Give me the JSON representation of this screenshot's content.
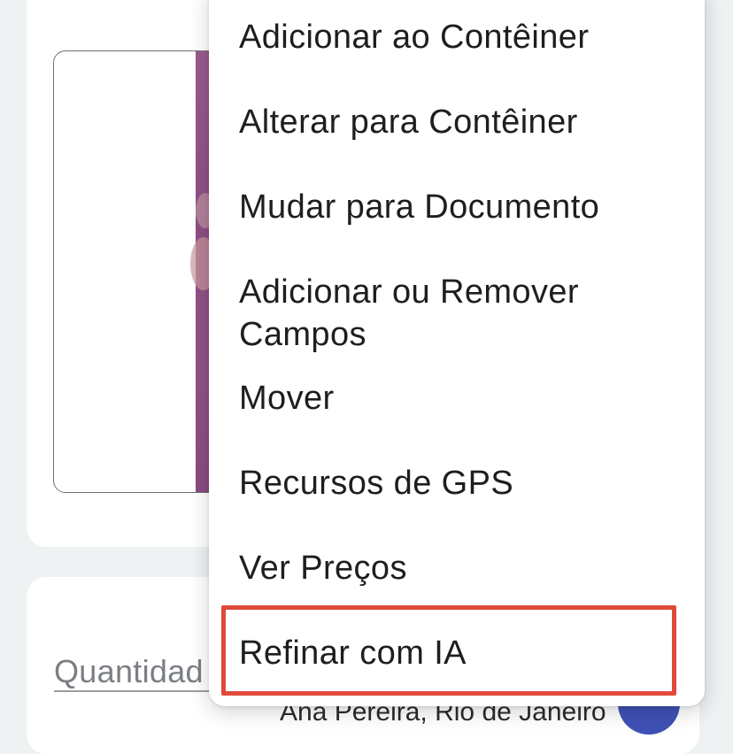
{
  "background_form": {
    "quantity_label": "Quantidad",
    "bottom_text": "Ana Pereira, Rio de Janeiro"
  },
  "context_menu": {
    "items": [
      {
        "label": "Adicionar ao Contêiner"
      },
      {
        "label": "Alterar para Contêiner"
      },
      {
        "label": "Mudar para Documento"
      },
      {
        "label": "Adicionar ou Remover Campos"
      },
      {
        "label": "Mover"
      },
      {
        "label": "Recursos de GPS"
      },
      {
        "label": "Ver Preços"
      },
      {
        "label": "Refinar com IA"
      }
    ],
    "highlighted_item": "Refinar com IA"
  },
  "colors": {
    "highlight_border": "#e04a3b",
    "fab": "#3f51b5",
    "photo": "#9a5b8f"
  }
}
